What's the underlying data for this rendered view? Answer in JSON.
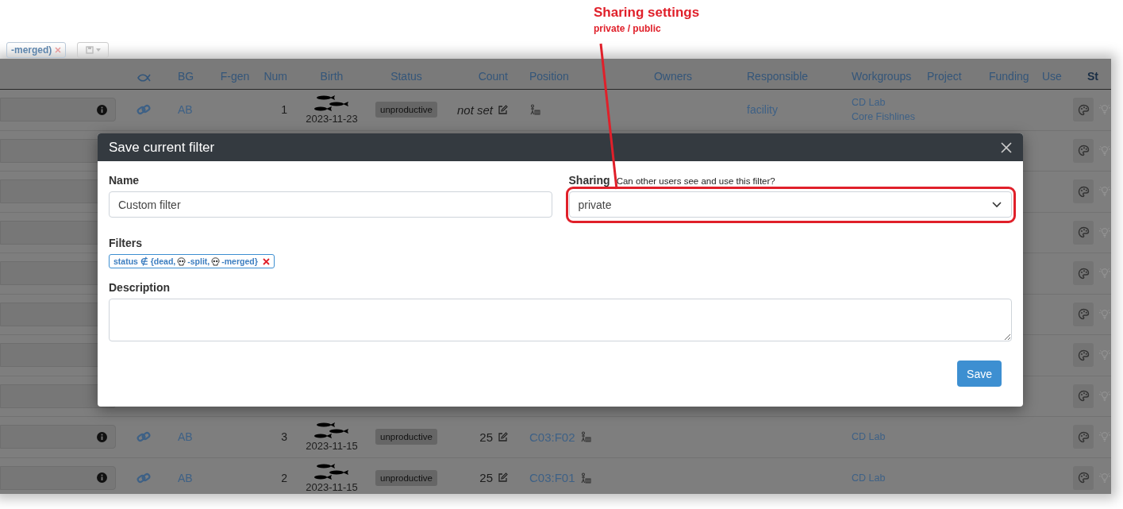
{
  "annotation": {
    "title": "Sharing settings",
    "subtitle": "private / public"
  },
  "toolbar": {
    "filter_chip": "-merged)"
  },
  "table": {
    "columns": [
      "BG",
      "F-gen",
      "Num",
      "Birth",
      "Status",
      "Count",
      "Position",
      "Owners",
      "Responsible",
      "Workgroups",
      "Project",
      "Funding",
      "Use",
      "St"
    ],
    "rows": [
      {
        "kind": "full",
        "bg": "AB",
        "num": "1",
        "birth": "2023-11-23",
        "status": "unproductive",
        "count": "not set",
        "count_set": false,
        "responsible": "facility",
        "workgroups": [
          "CD Lab",
          "Core Fishlines"
        ]
      },
      {
        "kind": "covered"
      },
      {
        "kind": "covered"
      },
      {
        "kind": "covered"
      },
      {
        "kind": "covered"
      },
      {
        "kind": "covered"
      },
      {
        "kind": "covered"
      },
      {
        "kind": "covered"
      },
      {
        "kind": "full",
        "bg": "AB",
        "num": "3",
        "birth": "2023-11-15",
        "status": "unproductive",
        "count": "25",
        "count_set": true,
        "position": "C03:F02",
        "workgroups": [
          "CD Lab"
        ]
      },
      {
        "kind": "full",
        "bg": "AB",
        "num": "2",
        "birth": "2023-11-15",
        "status": "unproductive",
        "count": "25",
        "count_set": true,
        "position": "C03:F01",
        "workgroups": [
          "CD Lab"
        ]
      }
    ]
  },
  "dialog": {
    "title": "Save current filter",
    "name": {
      "label": "Name",
      "value": "Custom filter"
    },
    "sharing": {
      "label": "Sharing",
      "hint": "Can other users see and use this filter?",
      "value": "private",
      "highlighted": true
    },
    "filters": {
      "label": "Filters",
      "chips": [
        {
          "parts": [
            {
              "kind": "text",
              "text": "status ∉ {dead, "
            },
            {
              "kind": "skull"
            },
            {
              "kind": "text",
              "text": "-split, "
            },
            {
              "kind": "skull"
            },
            {
              "kind": "text",
              "text": "-merged}"
            }
          ]
        }
      ]
    },
    "description": {
      "label": "Description"
    },
    "buttons": [
      "Save"
    ]
  }
}
